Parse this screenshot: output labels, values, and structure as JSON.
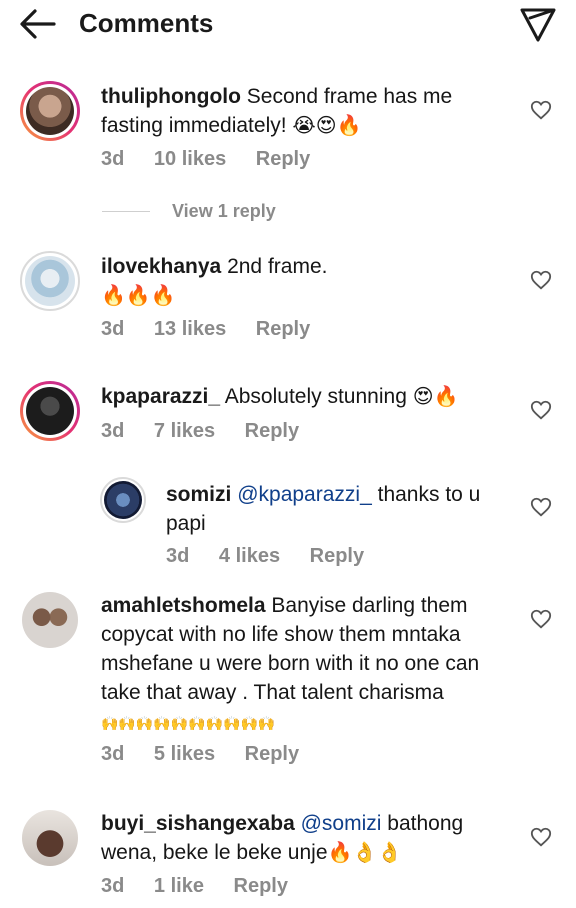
{
  "header": {
    "title": "Comments",
    "back_icon": "arrow-left-icon",
    "send_icon": "paper-plane-icon"
  },
  "comments": [
    {
      "username": "thuliphongolo",
      "text_line1": "Second frame has me",
      "text_line2": "fasting immediately!",
      "emojis": "😭😍🔥",
      "time": "3d",
      "likes": "10 likes",
      "reply": "Reply",
      "view_replies": "View 1 reply"
    },
    {
      "username": "ilovekhanya",
      "text_line1": "2nd frame.",
      "emojis": "🔥🔥🔥",
      "time": "3d",
      "likes": "13 likes",
      "reply": "Reply"
    },
    {
      "username": "kpaparazzi_",
      "text_line1": "Absolutely stunning",
      "emojis": "😍🔥",
      "time": "3d",
      "likes": "7 likes",
      "reply": "Reply"
    },
    {
      "username": "somizi",
      "mention": "@kpaparazzi_",
      "text_line1": "thanks to u",
      "text_line2": "papi",
      "time": "3d",
      "likes": "4 likes",
      "reply": "Reply"
    },
    {
      "username": "amahletshomela",
      "text_line1": "Banyise darling them",
      "text_line2": "copycat with no life show them mntaka",
      "text_line3": "mshefane u were born with it no one can",
      "text_line4": "take that away . That talent charisma",
      "emojis": "🙌🙌🙌🙌🙌🙌🙌🙌🙌🙌",
      "time": "3d",
      "likes": "5 likes",
      "reply": "Reply"
    },
    {
      "username": "buyi_sishangexaba",
      "mention": "@somizi",
      "text_line1": "bathong",
      "text_line2": "wena, beke le beke unje",
      "emojis": "🔥👌👌",
      "time": "3d",
      "likes": "1 like",
      "reply": "Reply"
    }
  ],
  "colors": {
    "text": "#161616",
    "meta": "#8a8a8a",
    "mention": "#103f8a",
    "story_ring": [
      "#f9a13b",
      "#e53272",
      "#b52a9b"
    ]
  }
}
